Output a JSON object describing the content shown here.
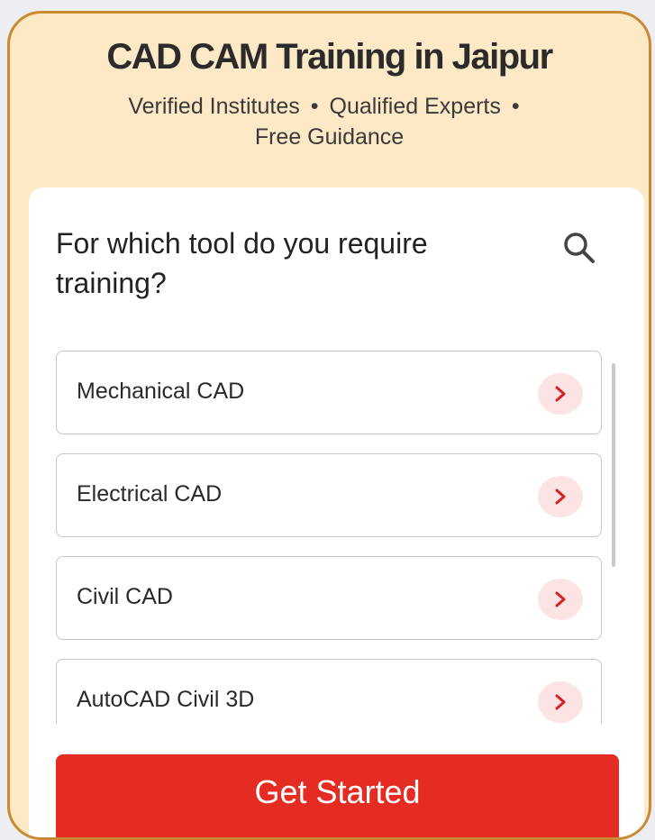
{
  "header": {
    "title": "CAD CAM Training in Jaipur",
    "features": [
      "Verified Institutes",
      "Qualified Experts",
      "Free Guidance"
    ],
    "separator": "•"
  },
  "panel": {
    "question": "For which tool do you require training?",
    "search_icon": "search-icon",
    "options": [
      {
        "label": "Mechanical CAD"
      },
      {
        "label": "Electrical CAD"
      },
      {
        "label": "Civil CAD"
      },
      {
        "label": "AutoCAD Civil 3D"
      }
    ],
    "chevron_icon": "chevron-right-icon"
  },
  "cta": {
    "label": "Get Started"
  },
  "colors": {
    "card_bg": "#fde9c6",
    "card_border": "#c98a34",
    "accent_red": "#e52c23",
    "chevron_bg": "#fde4e4"
  }
}
